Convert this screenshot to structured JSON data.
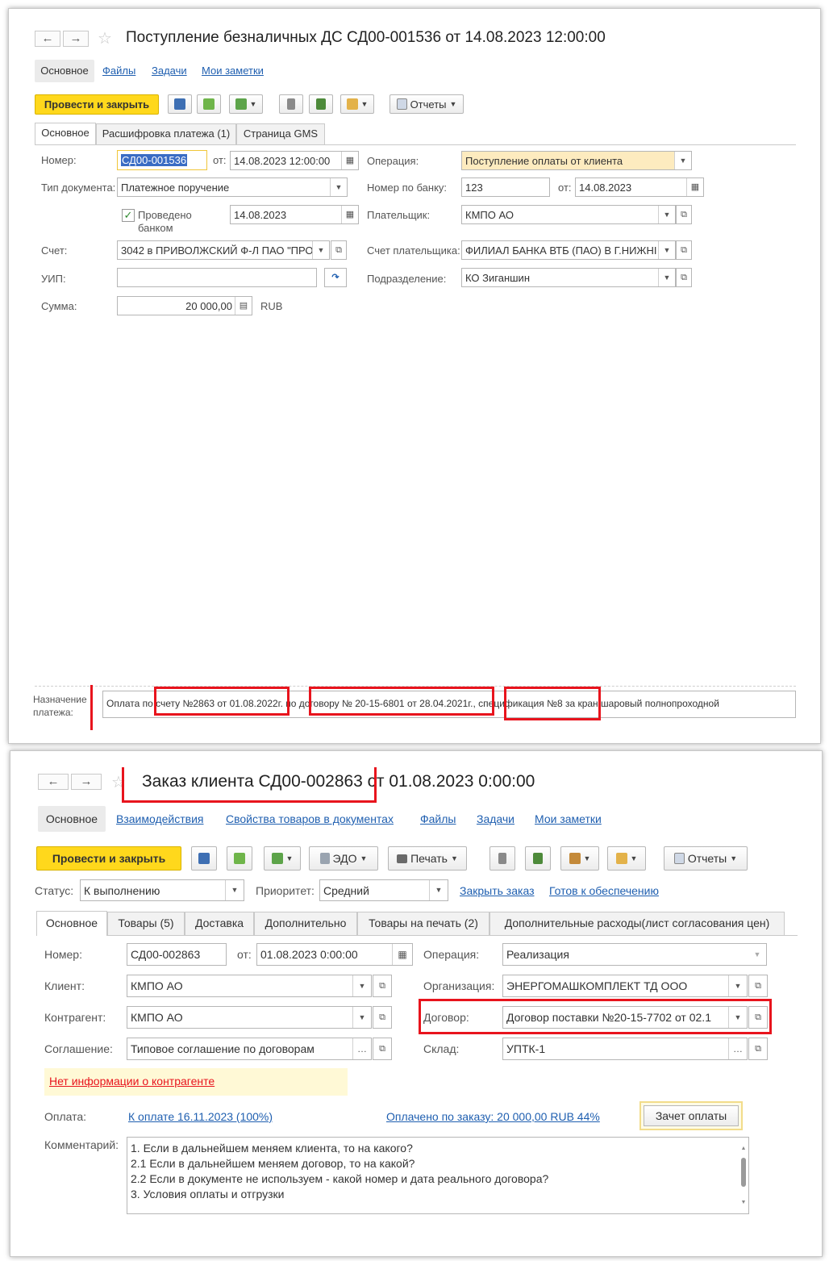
{
  "top": {
    "title": "Поступление безналичных ДС СД00-001536 от 14.08.2023 12:00:00",
    "nav_back": "←",
    "nav_forward": "→",
    "section_tabs": [
      "Основное",
      "Файлы",
      "Задачи",
      "Мои заметки"
    ],
    "primary_button": "Провести и закрыть",
    "reports_button": "Отчеты",
    "tabs": [
      "Основное",
      "Расшифровка платежа (1)",
      "Страница GMS"
    ],
    "fields": {
      "number_label": "Номер:",
      "number_value": "СД00-001536",
      "from_label": "от:",
      "date_value": "14.08.2023 12:00:00",
      "operation_label": "Операция:",
      "operation_value": "Поступление оплаты от клиента",
      "doctype_label": "Тип документа:",
      "doctype_value": "Платежное поручение",
      "bank_number_label": "Номер по банку:",
      "bank_number_value": "123",
      "bank_from_label": "от:",
      "bank_date_value": "14.08.2023",
      "posted_label_1": "Проведено",
      "posted_label_2": "банком",
      "posted_date_value": "14.08.2023",
      "payer_label": "Плательщик:",
      "payer_value": "КМПО АО",
      "account_label": "Счет:",
      "account_value": "3042 в ПРИВОЛЖСКИЙ Ф-Л ПАО \"ПРО",
      "payer_account_label": "Счет плательщика:",
      "payer_account_value": "ФИЛИАЛ БАНКА ВТБ (ПАО) В Г.НИЖНІ",
      "uip_label": "УИП:",
      "uip_value": "",
      "department_label": "Подразделение:",
      "department_value": "КО Зиганшин",
      "amount_label": "Сумма:",
      "amount_value": "20 000,00",
      "currency": "RUB"
    },
    "purpose_label_1": "Назначение",
    "purpose_label_2": "платежа:",
    "purpose_text": "Оплата по счету №2863 от 01.08.2022г. по договору № 20-15-6801 от 28.04.2021г., спецификация №8 за кран шаровый полнопроходной"
  },
  "bottom": {
    "title": "Заказ клиента СД00-002863 от 01.08.2023 0:00:00",
    "nav_back": "←",
    "nav_forward": "→",
    "section_tabs": [
      "Основное",
      "Взаимодействия",
      "Свойства товаров в документах",
      "Файлы",
      "Задачи",
      "Мои заметки"
    ],
    "primary_button": "Провести и закрыть",
    "edo_button": "ЭДО",
    "print_button": "Печать",
    "reports_button": "Отчеты",
    "status_label": "Статус:",
    "status_value": "К выполнению",
    "priority_label": "Приоритет:",
    "priority_value": "Средний",
    "close_order_link": "Закрыть заказ",
    "ready_link": "Готов к обеспечению",
    "tabs": [
      "Основное",
      "Товары (5)",
      "Доставка",
      "Дополнительно",
      "Товары на печать (2)",
      "Дополнительные расходы(лист согласования цен)"
    ],
    "fields": {
      "number_label": "Номер:",
      "number_value": "СД00-002863",
      "from_label": "от:",
      "date_value": "01.08.2023  0:00:00",
      "operation_label": "Операция:",
      "operation_value": "Реализация",
      "client_label": "Клиент:",
      "client_value": "КМПО АО",
      "org_label": "Организация:",
      "org_value": "ЭНЕРГОМАШКОМПЛЕКТ ТД ООО",
      "counterparty_label": "Контрагент:",
      "counterparty_value": "КМПО АО",
      "contract_label": "Договор:",
      "contract_value": "Договор поставки №20-15-7702 от 02.1",
      "agreement_label": "Соглашение:",
      "agreement_value": "Типовое соглашение по договорам",
      "warehouse_label": "Склад:",
      "warehouse_value": "УПТК-1"
    },
    "no_info_link": "Нет информации о контрагенте",
    "payment_label": "Оплата:",
    "payment_link": "К оплате 16.11.2023 (100%)",
    "paid_link": "Оплачено по заказу: 20 000,00 RUB 44%",
    "offset_button": "Зачет оплаты",
    "comment_label": "Комментарий:",
    "comment_lines": [
      "1. Если в дальнейшем меняем клиента, то на какого?",
      "2.1 Если в дальнейшем меняем договор, то на какой?",
      "2.2 Если в документе не используем - какой номер и дата реального договора?",
      "3. Условия оплаты и отгрузки"
    ]
  },
  "colors": {
    "primary_button": "#ffd81c",
    "highlight_red": "#e8141d",
    "link_blue": "#1f5fb0",
    "operation_field_bg": "#fdebbf",
    "warning_bg": "#fff9d6",
    "warning_text": "#e8141d"
  }
}
